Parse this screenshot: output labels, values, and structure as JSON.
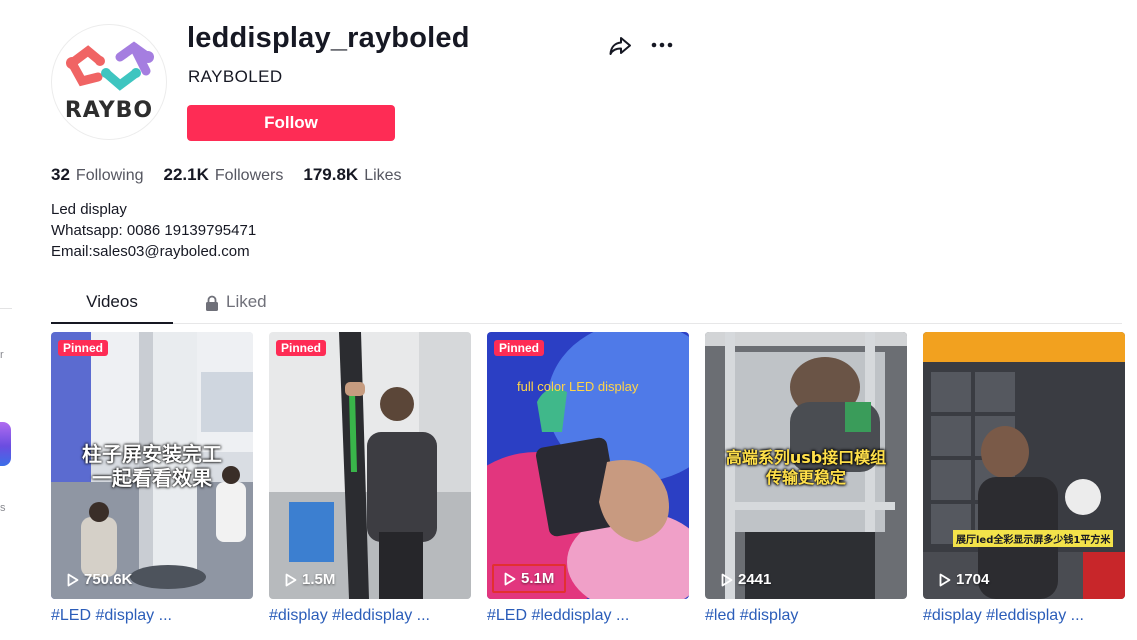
{
  "profile": {
    "username": "leddisplay_rayboled",
    "nickname": "RAYBOLED",
    "avatar_text": "RAYBO",
    "follow_label": "Follow",
    "stats": [
      {
        "value": "32",
        "label": "Following"
      },
      {
        "value": "22.1K",
        "label": "Followers"
      },
      {
        "value": "179.8K",
        "label": "Likes"
      }
    ],
    "bio": [
      "Led display",
      "Whatsapp: 0086 19139795471",
      "Email:sales03@rayboled.com"
    ]
  },
  "tabs": {
    "videos": "Videos",
    "liked": "Liked"
  },
  "sidebar_fragments": [
    "r",
    "s"
  ],
  "videos": [
    {
      "pinned_label": "Pinned",
      "views": "750.6K",
      "caption": "#LED #display ...",
      "overlay": [
        "柱子屏安装完工",
        "一起看看效果"
      ]
    },
    {
      "pinned_label": "Pinned",
      "views": "1.5M",
      "caption": "#display #leddisplay ..."
    },
    {
      "pinned_label": "Pinned",
      "views": "5.1M",
      "caption": "#LED #leddisplay ...",
      "overlay": [
        "full color LED display"
      ]
    },
    {
      "views": "2441",
      "caption": "#led #display",
      "overlay": [
        "高端系列usb接口模组",
        "传输更稳定"
      ]
    },
    {
      "views": "1704",
      "caption": "#display #leddisplay ...",
      "overlay": [
        "展厅led全彩显示屏多少钱1平方米"
      ]
    }
  ],
  "colors": {
    "brand_red": "#fe2c55",
    "text": "#161823",
    "secondary": "#555660",
    "link": "#2b5db9",
    "highlight_box": "#e23030"
  }
}
